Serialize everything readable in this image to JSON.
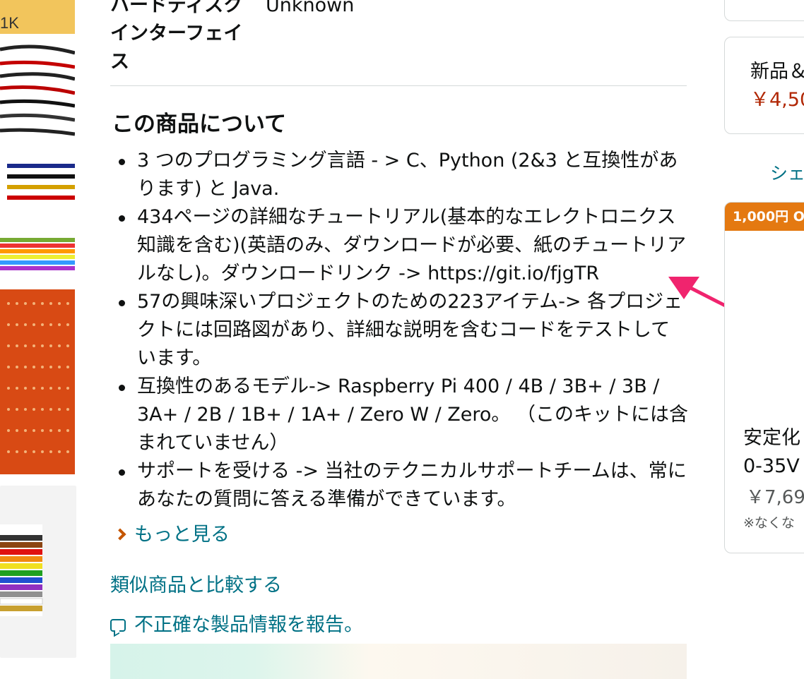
{
  "spec": {
    "label_line1": "ハードディスク",
    "label_line2": "インターフェイ",
    "label_line3": "ス",
    "value": "Unknown"
  },
  "about": {
    "title": "この商品について",
    "bullets": [
      "3 つのプログラミング言語 - > C、Python (2&3 と互換性があります) と Java.",
      "434ページの詳細なチュートリアル(基本的なエレクトロニクス知識を含む)(英語のみ、ダウンロードが必要、紙のチュートリアルなし)。ダウンロードリンク -> https://git.io/fjgTR",
      "57の興味深いプロジェクトのための223アイテム-> 各プロジェクトには回路図があり、詳細な説明を含むコードをテストしています。",
      "互換性のあるモデル-> Raspberry Pi 400 / 4B / 3B+ / 3B / 3A+ / 2B / 1B+ / 1A+ / Zero W / Zero。 （このキットには含まれていません）",
      "サポートを受ける -> 当社のテクニカルサポートチームは、常にあなたの質問に答える準備ができています。"
    ],
    "see_more": "もっと見る"
  },
  "links": {
    "compare": "類似商品と比較する",
    "report": "不正確な製品情報を報告。"
  },
  "right": {
    "new_label": "新品＆",
    "new_price": "￥4,50",
    "share": "シェ",
    "sponsor_badge": "1,000円 O",
    "sponsor_title": "安定化",
    "sponsor_spec": "0-35V",
    "sponsor_price": "￥7,69",
    "sponsor_note": "※なくな"
  },
  "colors": {
    "link": "#007185",
    "price": "#b12704",
    "badge": "#e47911",
    "arrow": "#f0246e"
  }
}
